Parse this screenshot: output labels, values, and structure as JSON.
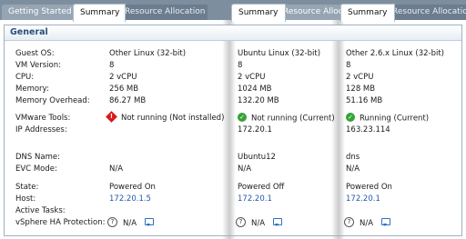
{
  "tabs": [
    {
      "label": "Getting Started",
      "state": "inactive"
    },
    {
      "label": "Summary",
      "state": "active"
    },
    {
      "label": "Resource Allocation",
      "state": "inactive"
    },
    {
      "label": "Summary",
      "state": "active"
    },
    {
      "label": "Resource Allocation",
      "state": "light"
    },
    {
      "label": "Summary",
      "state": "active"
    },
    {
      "label": "Resource Allocation",
      "state": "inactive"
    }
  ],
  "panel_title": "General",
  "labels": {
    "guest_os": "Guest OS:",
    "vm_version": "VM Version:",
    "cpu": "CPU:",
    "memory": "Memory:",
    "memory_overhead": "Memory Overhead:",
    "vmware_tools": "VMware Tools:",
    "ip_addresses": "IP Addresses:",
    "dns_name": "DNS Name:",
    "evc_mode": "EVC Mode:",
    "state": "State:",
    "host": "Host:",
    "active_tasks": "Active Tasks:",
    "ha_protection": "vSphere HA Protection:"
  },
  "vm1": {
    "guest_os": "Other Linux (32-bit)",
    "vm_version": "8",
    "cpu": "2 vCPU",
    "memory": "256 MB",
    "memory_overhead": "86.27 MB",
    "tools": "Not running (Not installed)",
    "ip": "",
    "dns": "",
    "evc": "N/A",
    "state": "Powered On",
    "host": "172.20.1.5",
    "ha": "N/A",
    "tools_icon": "error-diamond-icon"
  },
  "vm2": {
    "guest_os": "Ubuntu Linux (32-bit)",
    "vm_version": "8",
    "cpu": "2 vCPU",
    "memory": "1024 MB",
    "memory_overhead": "132.20 MB",
    "tools": "Not running (Current)",
    "ip": "172.20.1",
    "dns": "Ubuntu12",
    "evc": "N/A",
    "state": "Powered Off",
    "host": "172.20.1",
    "ha": "N/A",
    "tools_icon": "ok-check-icon"
  },
  "vm3": {
    "guest_os": "Other 2.6.x Linux (32-bit)",
    "vm_version": "8",
    "cpu": "2 vCPU",
    "memory": "128 MB",
    "memory_overhead": "51.16 MB",
    "tools": "Running (Current)",
    "ip": "163.23.114",
    "dns": "dns",
    "evc": "N/A",
    "state": "Powered On",
    "host": "172.20.1",
    "ha": "N/A",
    "tools_icon": "ok-check-icon"
  },
  "colors": {
    "tabbar": "#7d8f9f",
    "link": "#2159a8",
    "header_text": "#264f7c",
    "error": "#d9191c",
    "ok": "#36a33a"
  }
}
